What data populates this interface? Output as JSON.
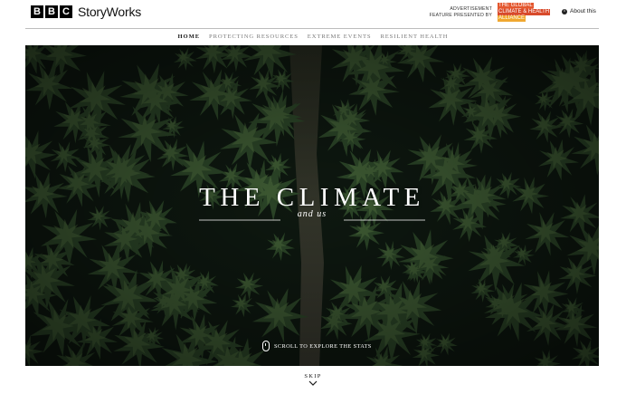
{
  "header": {
    "bbc_letters": [
      "B",
      "B",
      "C"
    ],
    "brand": "StoryWorks",
    "ad_line1": "ADVERTISEMENT",
    "ad_line2": "FEATURE PRESENTED BY",
    "sponsor_lines": [
      "THE GLOBAL",
      "CLIMATE & HEALTH",
      "ALLIANCE"
    ],
    "about_label": "About this"
  },
  "nav": {
    "items": [
      {
        "label": "HOME",
        "active": true
      },
      {
        "label": "PROTECTING RESOURCES",
        "active": false
      },
      {
        "label": "EXTREME EVENTS",
        "active": false
      },
      {
        "label": "RESILIENT HEALTH",
        "active": false
      }
    ]
  },
  "hero": {
    "title": "THE CLIMATE",
    "subtitle": "and us",
    "scroll_label": "SCROLL TO EXPLORE THE STATS"
  },
  "skip": {
    "label": "SKIP"
  },
  "colors": {
    "forest_dark": "#0f1a12",
    "tree": "#2f4a2a",
    "sponsor_red": "#e4572e",
    "sponsor_yellow": "#f0a830"
  }
}
